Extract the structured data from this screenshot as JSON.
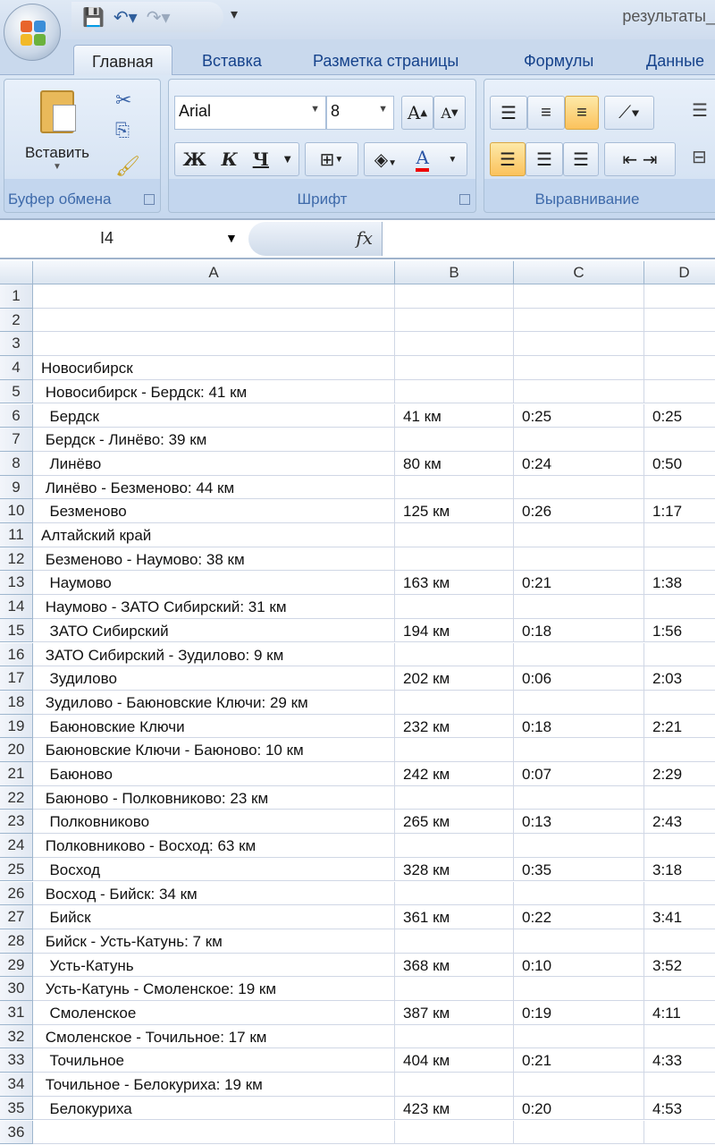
{
  "window": {
    "title": "результаты_"
  },
  "tabs": [
    "Главная",
    "Вставка",
    "Разметка страницы",
    "Формулы",
    "Данные"
  ],
  "ribbon": {
    "clipboard": {
      "label": "Буфер обмена",
      "paste": "Вставить"
    },
    "font": {
      "label": "Шрифт",
      "name": "Arial",
      "size": "8",
      "bold": "Ж",
      "italic": "К",
      "underline": "Ч",
      "grow": "A",
      "shrink": "A",
      "color": "A"
    },
    "alignment": {
      "label": "Выравнивание"
    }
  },
  "formula_bar": {
    "name_box": "I4",
    "fx": "fx",
    "value": ""
  },
  "columns": [
    "A",
    "B",
    "C",
    "D"
  ],
  "rows": [
    [
      "1",
      "",
      "",
      "",
      ""
    ],
    [
      "2",
      "",
      "",
      "",
      ""
    ],
    [
      "3",
      "",
      "",
      "",
      ""
    ],
    [
      "4",
      "Новосибирск",
      "",
      "",
      ""
    ],
    [
      "5",
      " Новосибирск - Бердск: 41 км",
      "",
      "",
      ""
    ],
    [
      "6",
      "  Бердск",
      "41 км",
      "0:25",
      "0:25"
    ],
    [
      "7",
      " Бердск - Линёво: 39 км",
      "",
      "",
      ""
    ],
    [
      "8",
      "  Линёво",
      "80 км",
      "0:24",
      "0:50"
    ],
    [
      "9",
      " Линёво - Безменово: 44 км",
      "",
      "",
      ""
    ],
    [
      "10",
      "  Безменово",
      "125 км",
      "0:26",
      "1:17"
    ],
    [
      "11",
      "Алтайский край",
      "",
      "",
      ""
    ],
    [
      "12",
      " Безменово - Наумово: 38 км",
      "",
      "",
      ""
    ],
    [
      "13",
      "  Наумово",
      "163 км",
      "0:21",
      "1:38"
    ],
    [
      "14",
      " Наумово - ЗАТО Сибирский: 31 км",
      "",
      "",
      ""
    ],
    [
      "15",
      "  ЗАТО Сибирский",
      "194 км",
      "0:18",
      "1:56"
    ],
    [
      "16",
      " ЗАТО Сибирский - Зудилово: 9 км",
      "",
      "",
      ""
    ],
    [
      "17",
      "  Зудилово",
      "202 км",
      "0:06",
      "2:03"
    ],
    [
      "18",
      " Зудилово - Баюновские Ключи: 29 км",
      "",
      "",
      ""
    ],
    [
      "19",
      "  Баюновские Ключи",
      "232 км",
      "0:18",
      "2:21"
    ],
    [
      "20",
      " Баюновские Ключи - Баюново: 10 км",
      "",
      "",
      ""
    ],
    [
      "21",
      "  Баюново",
      "242 км",
      "0:07",
      "2:29"
    ],
    [
      "22",
      " Баюново - Полковниково: 23 км",
      "",
      "",
      ""
    ],
    [
      "23",
      "  Полковниково",
      "265 км",
      "0:13",
      "2:43"
    ],
    [
      "24",
      " Полковниково - Восход: 63 км",
      "",
      "",
      ""
    ],
    [
      "25",
      "  Восход",
      "328 км",
      "0:35",
      "3:18"
    ],
    [
      "26",
      " Восход - Бийск: 34 км",
      "",
      "",
      ""
    ],
    [
      "27",
      "  Бийск",
      "361 км",
      "0:22",
      "3:41"
    ],
    [
      "28",
      " Бийск - Усть-Катунь: 7 км",
      "",
      "",
      ""
    ],
    [
      "29",
      "  Усть-Катунь",
      "368 км",
      "0:10",
      "3:52"
    ],
    [
      "30",
      " Усть-Катунь - Смоленское: 19 км",
      "",
      "",
      ""
    ],
    [
      "31",
      "  Смоленское",
      "387 км",
      "0:19",
      "4:11"
    ],
    [
      "32",
      " Смоленское - Точильное: 17 км",
      "",
      "",
      ""
    ],
    [
      "33",
      "  Точильное",
      "404 км",
      "0:21",
      "4:33"
    ],
    [
      "34",
      " Точильное - Белокуриха: 19 км",
      "",
      "",
      ""
    ],
    [
      "35",
      "  Белокуриха",
      "423 км",
      "0:20",
      "4:53"
    ],
    [
      "36",
      "",
      "",
      "",
      ""
    ]
  ]
}
